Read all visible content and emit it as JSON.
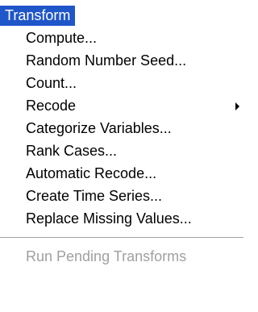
{
  "menu": {
    "title": "Transform",
    "items": [
      {
        "label": "Compute..."
      },
      {
        "label": "Random Number Seed..."
      },
      {
        "label": "Count..."
      },
      {
        "label": "Recode",
        "submenu": true
      },
      {
        "label": "Categorize Variables..."
      },
      {
        "label": "Rank Cases..."
      },
      {
        "label": "Automatic Recode..."
      },
      {
        "label": "Create Time Series..."
      },
      {
        "label": "Replace Missing Values..."
      }
    ],
    "disabled_item": {
      "label": "Run Pending Transforms"
    }
  },
  "colors": {
    "title_highlight": "#1f56c9",
    "title_text": "#ffffff",
    "item_text": "#000000",
    "disabled_text": "#a0a0a0"
  },
  "icons": {
    "submenu": "triangle-right-icon"
  }
}
